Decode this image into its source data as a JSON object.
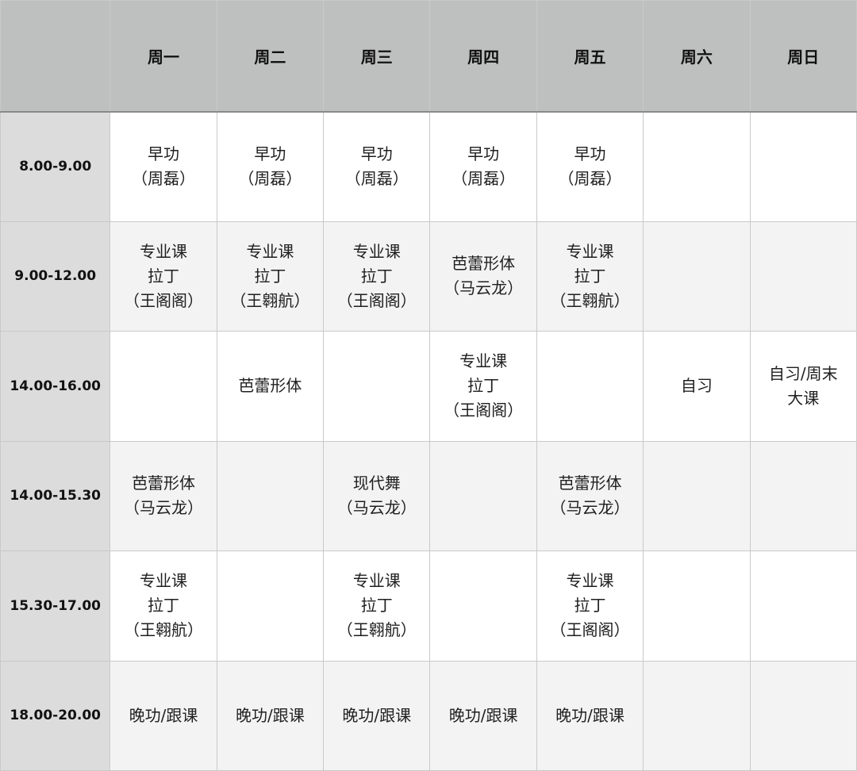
{
  "corner": "",
  "days": [
    "周一",
    "周二",
    "周三",
    "周四",
    "周五",
    "周六",
    "周日"
  ],
  "rows": [
    {
      "time": "8.00-9.00",
      "cells": [
        "早功\n（周磊）",
        "早功\n（周磊）",
        "早功\n（周磊）",
        "早功\n（周磊）",
        "早功\n（周磊）",
        "",
        ""
      ]
    },
    {
      "time": "9.00-12.00",
      "cells": [
        "专业课\n拉丁\n（王阁阁）",
        "专业课\n拉丁\n（王翱航）",
        "专业课\n拉丁\n（王阁阁）",
        "芭蕾形体\n（马云龙）",
        "专业课\n拉丁\n（王翱航）",
        "",
        ""
      ]
    },
    {
      "time": "14.00-16.00",
      "cells": [
        "",
        "芭蕾形体",
        "",
        "专业课\n拉丁\n（王阁阁）",
        "",
        "自习",
        "自习/周末\n大课"
      ]
    },
    {
      "time": "14.00-15.30",
      "cells": [
        "芭蕾形体\n（马云龙）",
        "",
        "现代舞\n（马云龙）",
        "",
        "芭蕾形体\n（马云龙）",
        "",
        ""
      ]
    },
    {
      "time": "15.30-17.00",
      "cells": [
        "专业课\n拉丁\n（王翱航）",
        "",
        "专业课\n拉丁\n（王翱航）",
        "",
        "专业课\n拉丁\n（王阁阁）",
        "",
        ""
      ]
    },
    {
      "time": "18.00-20.00",
      "cells": [
        "晚功/跟课",
        "晚功/跟课",
        "晚功/跟课",
        "晚功/跟课",
        "晚功/跟课",
        "",
        ""
      ]
    }
  ]
}
